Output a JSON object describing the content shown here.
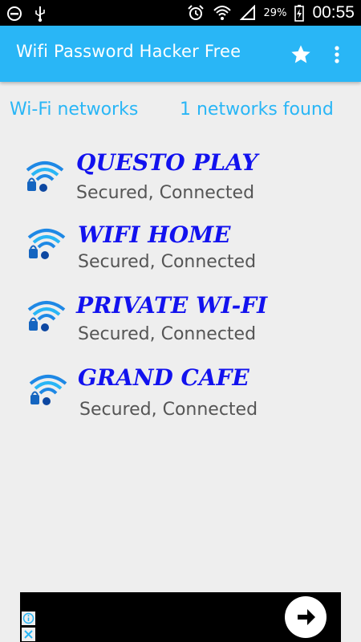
{
  "status_bar": {
    "battery_percent": "29%",
    "time": "00:55"
  },
  "app_bar": {
    "title": "Wifi Password Hacker Free"
  },
  "header": {
    "label": "Wi-Fi networks",
    "count_text": "1 networks found"
  },
  "networks": [
    {
      "name": "QUESTO PLAY",
      "status": "Secured, Connected"
    },
    {
      "name": "WIFI HOME",
      "status": "Secured, Connected"
    },
    {
      "name": "PRIVATE WI-FI",
      "status": "Secured, Connected"
    },
    {
      "name": "GRAND CAFE",
      "status": "Secured, Connected"
    }
  ],
  "icons": {
    "network": "wifi-lock-icon",
    "favorite": "star-icon",
    "overflow": "more-vert-icon"
  },
  "colors": {
    "app_bar": "#29b6f6",
    "accent_text": "#29b6f6",
    "network_name": "#1212ee",
    "status_text": "#555555",
    "background": "#eeeeee"
  }
}
